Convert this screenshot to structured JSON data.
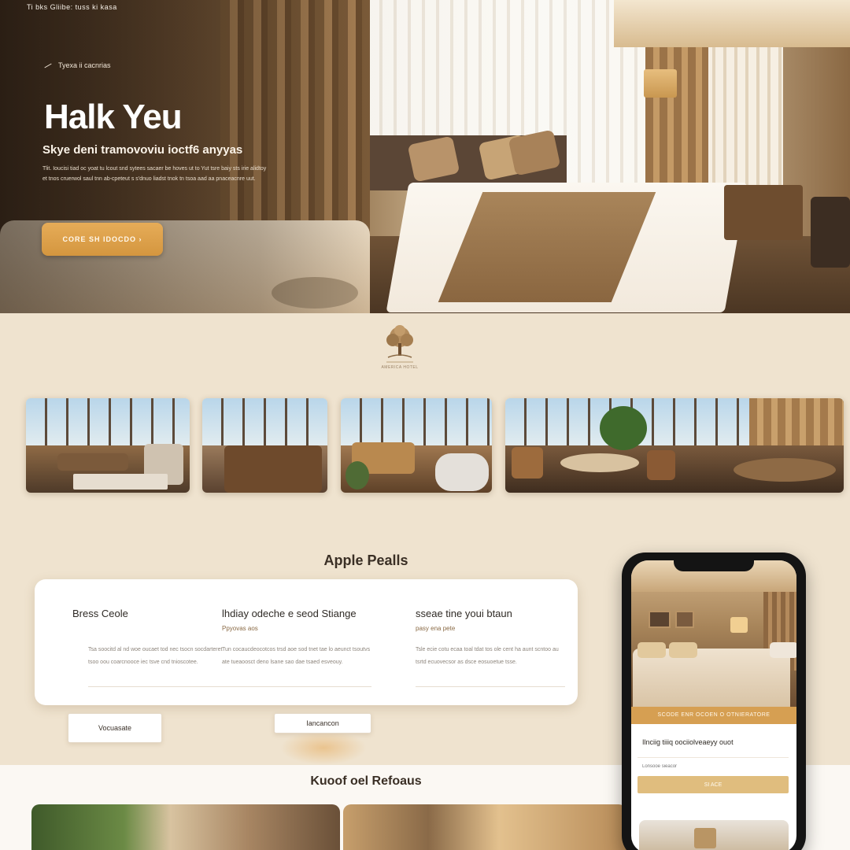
{
  "topbar": {
    "text": "Ti bks Gliibe: tuss ki kasa"
  },
  "hero": {
    "eyebrow": "Tyexa ii cacnrias",
    "title": "Halk Yeu",
    "subtitle": "Skye deni tramovoviu ioctf6 anyyas",
    "description": "Tlit. Ioucisi tiad oc yoat tu lcout snd sytees sacaer be hoves ut to Yut tsre baiy sts irie alidtoy et tnos cruerwol saul tnn ab-cpeteut s s'dnuo liadst tnok tn tsoa aad aa pnaceacnre uut.",
    "cta_label": "CORE SH IDOCDO ›"
  },
  "brand": {
    "logo_caption": "AMERICA HOTEL"
  },
  "features": {
    "title": "Apple Pealls",
    "items": [
      {
        "title": "Bress Ceole",
        "subtitle": "",
        "text": "Tsa soocitd al nd woe oucaet tod nec tsocn socdarteret tsoo oou coarcnooce iec tsve cnd tnioscotee."
      },
      {
        "title": "lhdiay odeche e seod Stiange",
        "subtitle": "Ppyovas aos",
        "text": "Tun cocaucdeocotcos trsd aoe sod tnet tae lo aeunct tsoutvs ate tueaoosct deno lsane sao dae tsaed esveouy."
      },
      {
        "title": "sseae tine youi btaun",
        "subtitle": "pasy ena pete",
        "text": "Tsle ecie cotu ecaa toal tdat tos ole cent ha aunt scntoo au tsrtd ecuovecsor as dsce eosuoetue tsse."
      }
    ],
    "button_left": "Vocuasate",
    "button_center": "Iancancon"
  },
  "phone": {
    "banner": "SCODE ENR OCOEN O OTNIERATORE",
    "heading": "Ilnciig tiiiq oociiolveaeyy ouot",
    "input_placeholder": "Lonsooe sieacor",
    "button_label": "SI ACE"
  },
  "rooms": {
    "title": "Kuoof oel Refoaus"
  },
  "colors": {
    "accent": "#d69f52",
    "background": "#efe3cf",
    "card": "#ffffff",
    "text_dark": "#2f2a25"
  }
}
